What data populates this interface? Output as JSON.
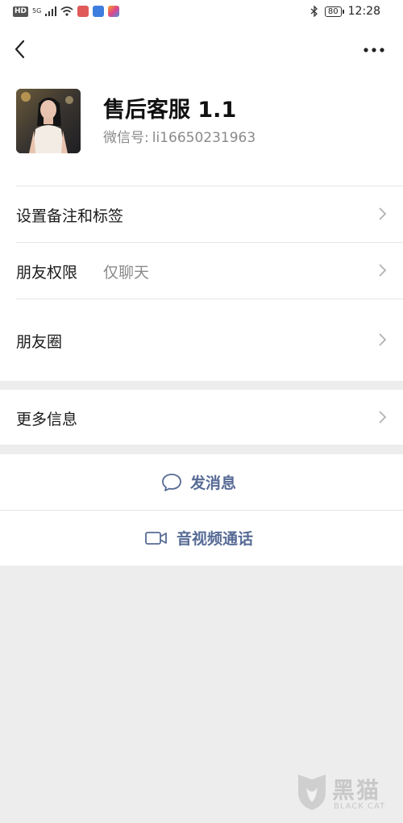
{
  "status_bar": {
    "network": "HD",
    "signal": "5G",
    "time": "12:28",
    "battery": "80"
  },
  "profile": {
    "name": "售后客服 1.1",
    "wechat_id_label": "微信号:",
    "wechat_id": "li16650231963"
  },
  "rows": {
    "remark_label": "设置备注和标签",
    "permission_label": "朋友权限",
    "permission_value": "仅聊天",
    "moments_label": "朋友圈",
    "more_info_label": "更多信息"
  },
  "actions": {
    "message_label": "发消息",
    "call_label": "音视频通话"
  },
  "watermark": {
    "brand_cn": "黑猫",
    "brand_en": "BLACK CAT"
  },
  "colors": {
    "accent": "#576b95",
    "background": "#ededed",
    "panel": "#ffffff"
  }
}
